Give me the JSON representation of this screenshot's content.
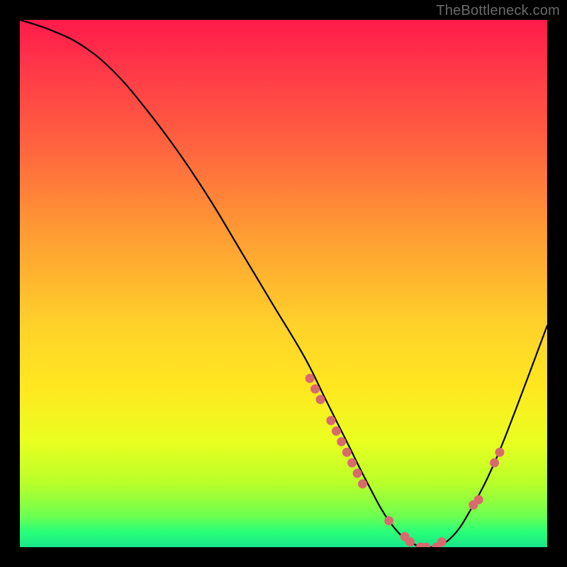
{
  "watermark": "TheBottleneck.com",
  "chart_data": {
    "type": "line",
    "title": "",
    "xlabel": "",
    "ylabel": "",
    "xlim": [
      0,
      100
    ],
    "ylim": [
      0,
      100
    ],
    "grid": false,
    "legend": false,
    "series": [
      {
        "name": "bottleneck-curve",
        "x": [
          0,
          6,
          12,
          18,
          24,
          30,
          36,
          42,
          48,
          54,
          58,
          62,
          66,
          70,
          74,
          78,
          82,
          86,
          90,
          94,
          100
        ],
        "y": [
          100,
          98,
          95,
          90,
          83,
          75,
          66,
          56,
          46,
          36,
          28,
          20,
          12,
          5,
          1,
          0,
          2,
          8,
          16,
          26,
          42
        ]
      }
    ],
    "highlight_points": {
      "name": "marked-dots",
      "x": [
        55,
        56,
        57,
        59,
        60,
        61,
        62,
        63,
        64,
        65,
        70,
        73,
        74,
        76,
        77,
        79,
        80,
        86,
        87,
        90,
        91
      ],
      "y": [
        32,
        30,
        28,
        24,
        22,
        20,
        18,
        16,
        14,
        12,
        5,
        2,
        1,
        0,
        0,
        0,
        1,
        8,
        9,
        16,
        18
      ]
    },
    "background_gradient": {
      "top": "#ff1a4b",
      "mid": "#ffe820",
      "bottom": "#17e68a"
    }
  }
}
